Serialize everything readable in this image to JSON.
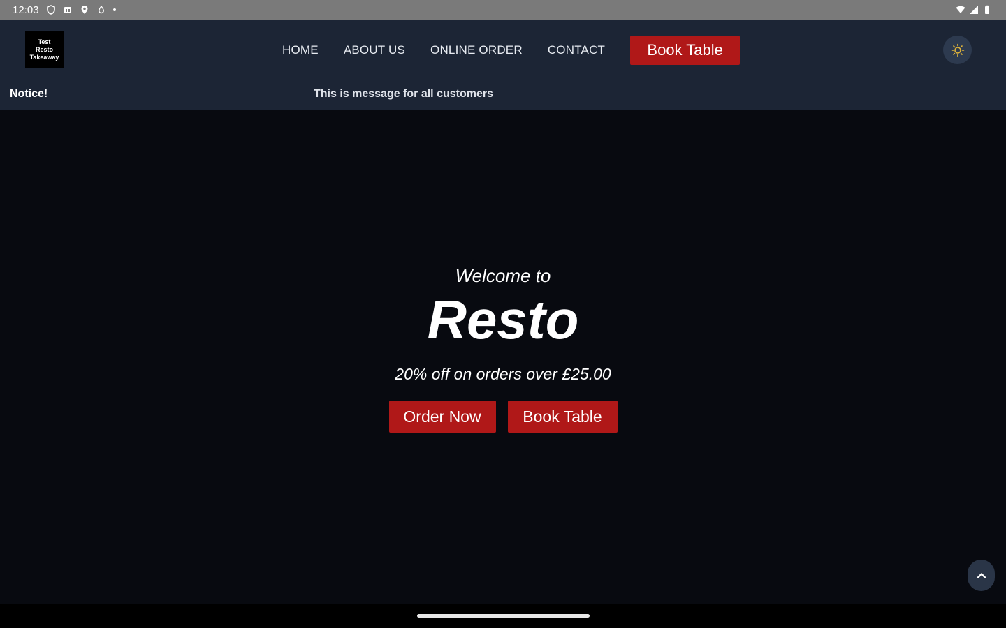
{
  "status_bar": {
    "time": "12:03",
    "icons_left": [
      "shield-icon",
      "sim-icon",
      "location-icon",
      "drop-icon",
      "dot-icon"
    ],
    "icons_right": [
      "wifi-icon",
      "signal-icon",
      "battery-icon"
    ]
  },
  "header": {
    "logo_lines": [
      "Test",
      "Resto",
      "Takeaway"
    ],
    "nav": [
      {
        "label": "HOME"
      },
      {
        "label": "ABOUT US"
      },
      {
        "label": "ONLINE ORDER"
      },
      {
        "label": "CONTACT"
      }
    ],
    "book_button": "Book Table",
    "theme_icon": "sun-icon",
    "notice_label": "Notice!",
    "notice_message": "This is message for all customers"
  },
  "hero": {
    "welcome": "Welcome to",
    "brand": "Resto",
    "offer": "20% off on orders over £25.00",
    "order_button": "Order Now",
    "book_button": "Book Table"
  },
  "scroll_top_icon": "chevron-up-icon",
  "colors": {
    "accent": "#b01818",
    "header_bg": "#1c2535",
    "hero_bg": "#080a10",
    "sun": "#e0b43a"
  }
}
